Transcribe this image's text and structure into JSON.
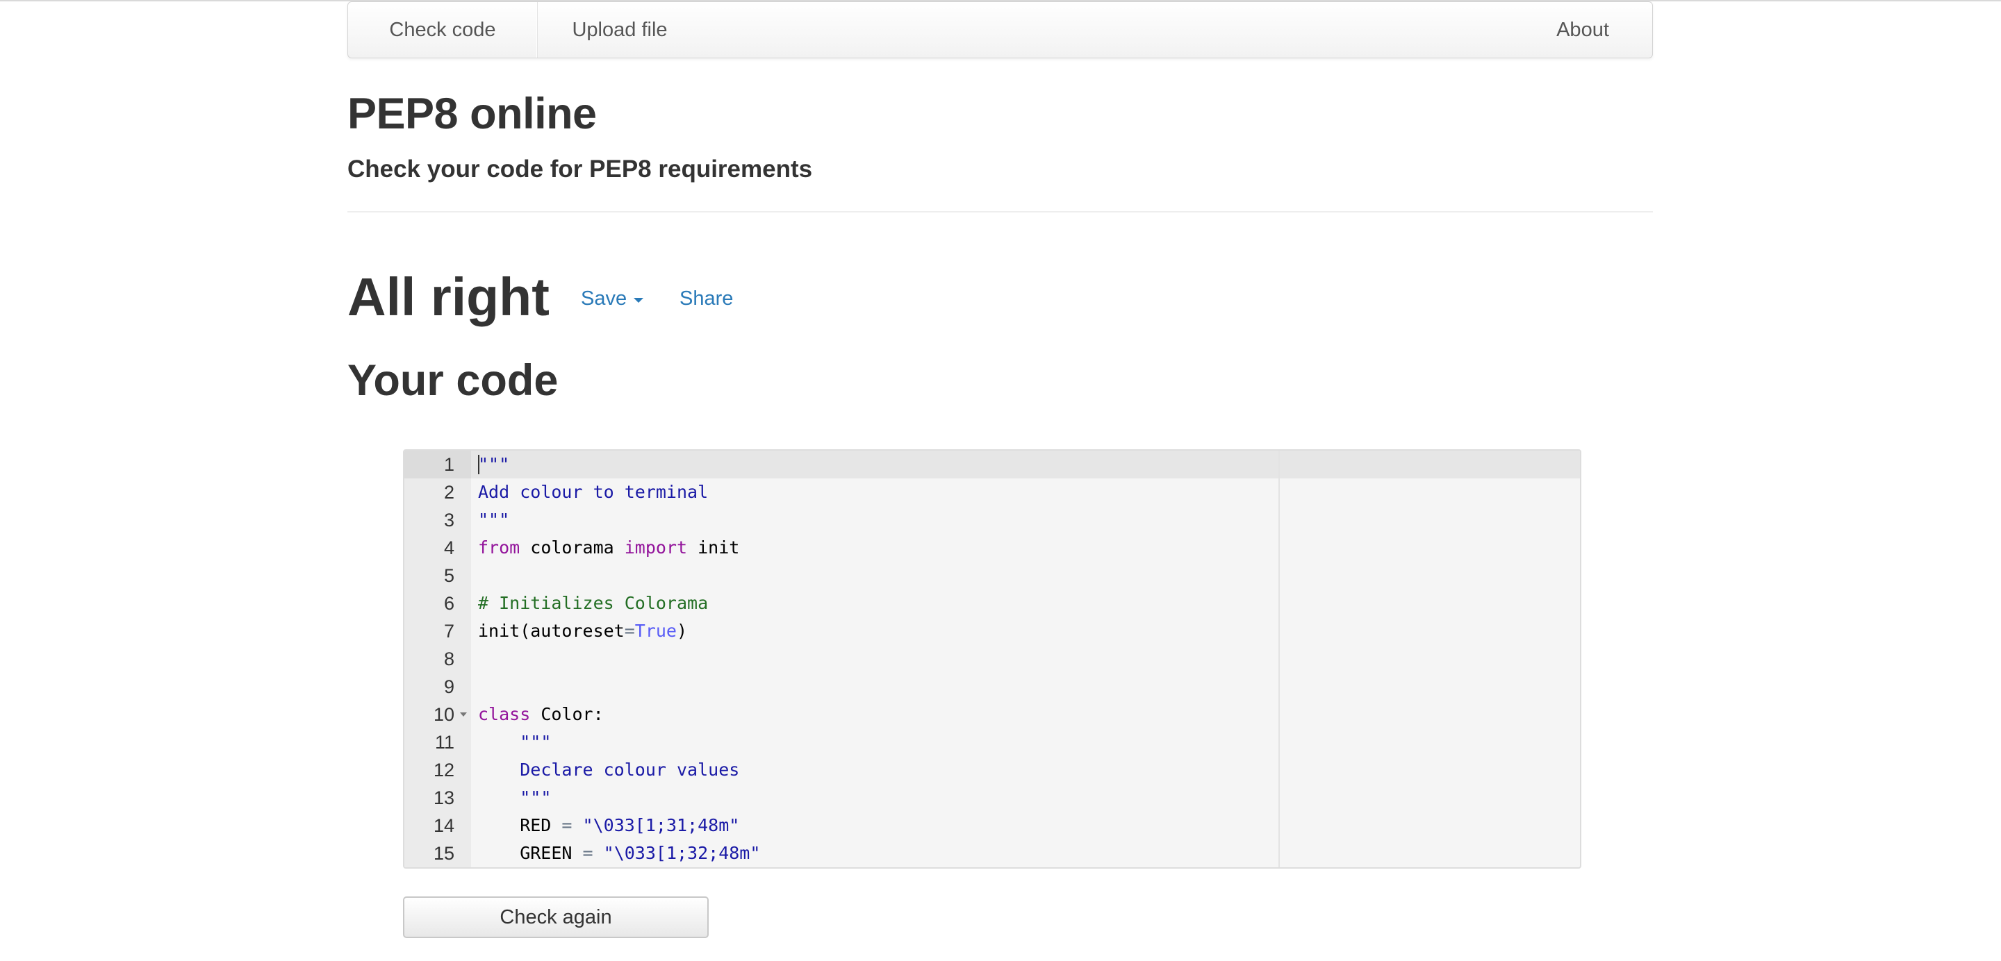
{
  "nav": {
    "check_code": "Check code",
    "upload_file": "Upload file",
    "about": "About"
  },
  "header": {
    "title": "PEP8 online",
    "subtitle": "Check your code for PEP8 requirements"
  },
  "result": {
    "title": "All right",
    "save_label": "Save",
    "share_label": "Share"
  },
  "code_section": {
    "heading": "Your code"
  },
  "editor": {
    "lines": [
      {
        "n": "1",
        "tokens": [
          {
            "t": "\"\"\"",
            "c": "string"
          }
        ]
      },
      {
        "n": "2",
        "tokens": [
          {
            "t": "Add colour to terminal",
            "c": "string"
          }
        ]
      },
      {
        "n": "3",
        "tokens": [
          {
            "t": "\"\"\"",
            "c": "string"
          }
        ]
      },
      {
        "n": "4",
        "tokens": [
          {
            "t": "from",
            "c": "keyword"
          },
          {
            "t": " colorama ",
            "c": "plain"
          },
          {
            "t": "import",
            "c": "keyword"
          },
          {
            "t": " init",
            "c": "plain"
          }
        ]
      },
      {
        "n": "5",
        "tokens": []
      },
      {
        "n": "6",
        "tokens": [
          {
            "t": "# Initializes Colorama",
            "c": "comment"
          }
        ]
      },
      {
        "n": "7",
        "tokens": [
          {
            "t": "init(autoreset",
            "c": "plain"
          },
          {
            "t": "=",
            "c": "op"
          },
          {
            "t": "True",
            "c": "const"
          },
          {
            "t": ")",
            "c": "plain"
          }
        ]
      },
      {
        "n": "8",
        "tokens": []
      },
      {
        "n": "9",
        "tokens": []
      },
      {
        "n": "10",
        "fold": true,
        "tokens": [
          {
            "t": "class",
            "c": "keyword"
          },
          {
            "t": " Color:",
            "c": "plain"
          }
        ]
      },
      {
        "n": "11",
        "tokens": [
          {
            "t": "    ",
            "c": "plain"
          },
          {
            "t": "\"\"\"",
            "c": "string"
          }
        ]
      },
      {
        "n": "12",
        "tokens": [
          {
            "t": "    ",
            "c": "plain"
          },
          {
            "t": "Declare colour values",
            "c": "string"
          }
        ]
      },
      {
        "n": "13",
        "tokens": [
          {
            "t": "    ",
            "c": "plain"
          },
          {
            "t": "\"\"\"",
            "c": "string"
          }
        ]
      },
      {
        "n": "14",
        "tokens": [
          {
            "t": "    RED ",
            "c": "plain"
          },
          {
            "t": "=",
            "c": "op"
          },
          {
            "t": " ",
            "c": "plain"
          },
          {
            "t": "\"\\033[1;31;48m\"",
            "c": "string"
          }
        ]
      },
      {
        "n": "15",
        "tokens": [
          {
            "t": "    GREEN ",
            "c": "plain"
          },
          {
            "t": "=",
            "c": "op"
          },
          {
            "t": " ",
            "c": "plain"
          },
          {
            "t": "\"\\033[1;32;48m\"",
            "c": "string"
          }
        ]
      }
    ]
  },
  "actions": {
    "check_again": "Check again"
  },
  "colors": {
    "link": "#2a7ab8",
    "string": "#1a1aa6",
    "keyword": "#93149b",
    "comment": "#236e24",
    "constant": "#585cf6"
  }
}
